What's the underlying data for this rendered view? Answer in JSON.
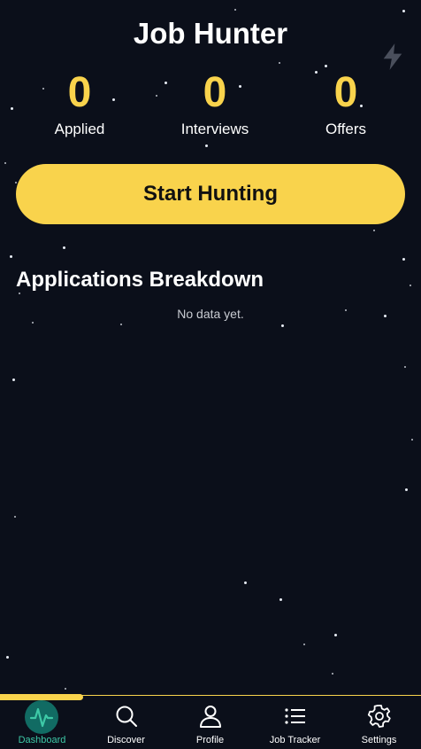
{
  "app": {
    "title": "Job Hunter"
  },
  "stats": [
    {
      "value": "0",
      "label": "Applied"
    },
    {
      "value": "0",
      "label": "Interviews"
    },
    {
      "value": "0",
      "label": "Offers"
    }
  ],
  "actions": {
    "start_label": "Start Hunting"
  },
  "breakdown": {
    "title": "Applications Breakdown",
    "empty_text": "No data yet."
  },
  "tabs": [
    {
      "label": "Dashboard",
      "icon": "activity-icon",
      "active": true
    },
    {
      "label": "Discover",
      "icon": "search-icon"
    },
    {
      "label": "Profile",
      "icon": "user-icon"
    },
    {
      "label": "Job Tracker",
      "icon": "list-icon"
    },
    {
      "label": "Settings",
      "icon": "gear-icon"
    }
  ],
  "colors": {
    "background": "#0b0f1a",
    "accent": "#f9d34c",
    "active_tab": "#3ec9a7"
  }
}
